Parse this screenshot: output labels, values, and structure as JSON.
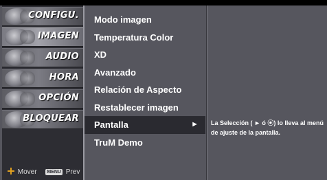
{
  "categories": [
    {
      "label": "CONFIGU.",
      "icon": "setup-icon",
      "active": false
    },
    {
      "label": "IMAGEN",
      "icon": "picture-icon",
      "active": true
    },
    {
      "label": "AUDIO",
      "icon": "audio-icon",
      "active": false
    },
    {
      "label": "HORA",
      "icon": "clock-icon",
      "active": false
    },
    {
      "label": "OPCIÓN",
      "icon": "option-icon",
      "active": false
    },
    {
      "label": "BLOQUEAR",
      "icon": "lock-icon",
      "active": false
    }
  ],
  "footer": {
    "move_label": "Mover",
    "menu_key": "MENU",
    "prev_label": "Prev"
  },
  "submenu": {
    "items": [
      {
        "label": "Modo imagen"
      },
      {
        "label": "Temperatura Color"
      },
      {
        "label": "XD"
      },
      {
        "label": "Avanzado"
      },
      {
        "label": "Relación de Aspecto"
      },
      {
        "label": "Restablecer imagen"
      },
      {
        "label": "Pantalla",
        "selected": true,
        "arrow": "►"
      },
      {
        "label": "TruM Demo"
      }
    ]
  },
  "info": {
    "line1": "La Selección ( ► ó ⦿) lo lleva al menú",
    "line2": "de ajuste de la pantalla."
  },
  "colors": {
    "panel": "#56565e",
    "left_menu": "#2d2d33",
    "selected_row": "#2a2a30",
    "text": "#ffffff"
  }
}
